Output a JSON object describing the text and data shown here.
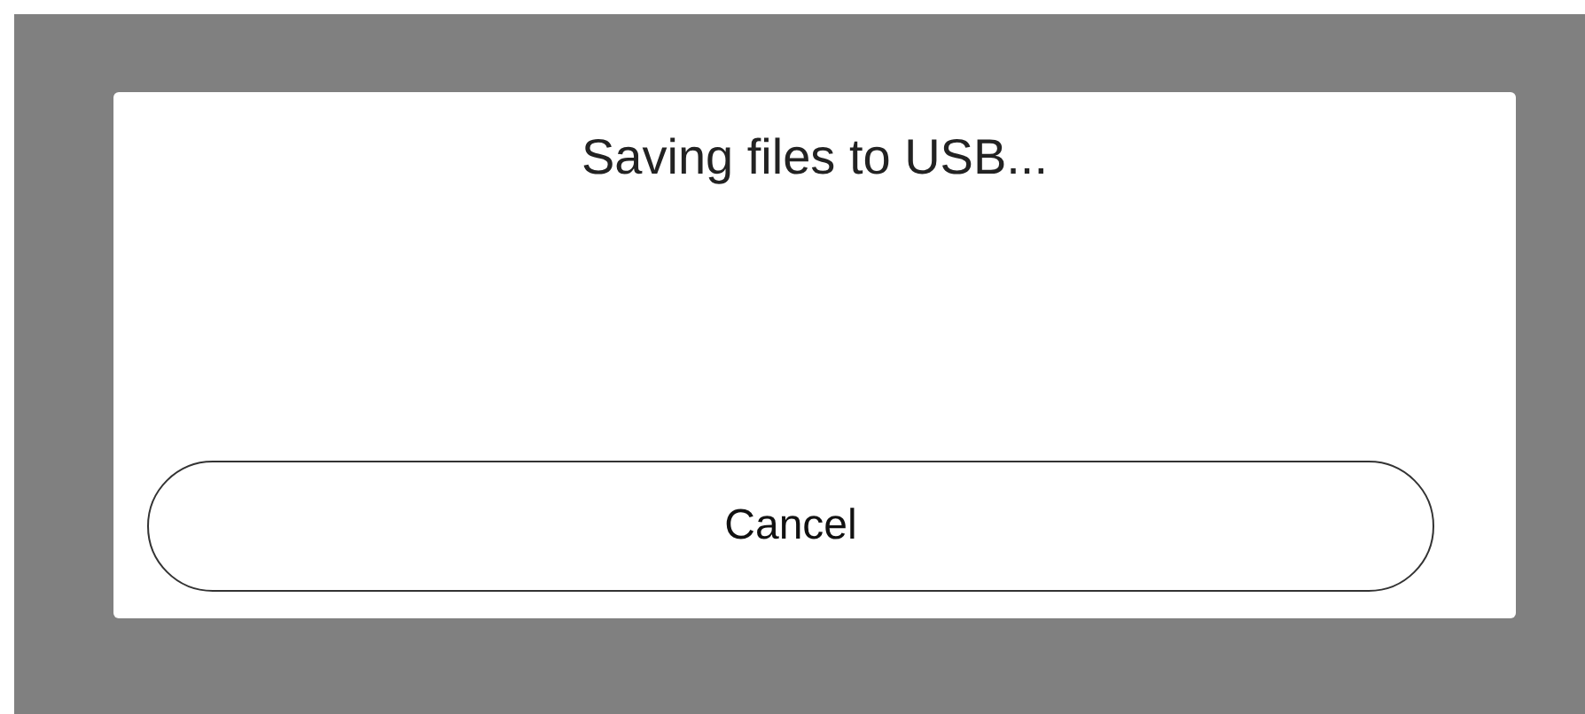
{
  "dialog": {
    "title": "Saving files to USB...",
    "buttons": [
      "Cancel"
    ]
  }
}
